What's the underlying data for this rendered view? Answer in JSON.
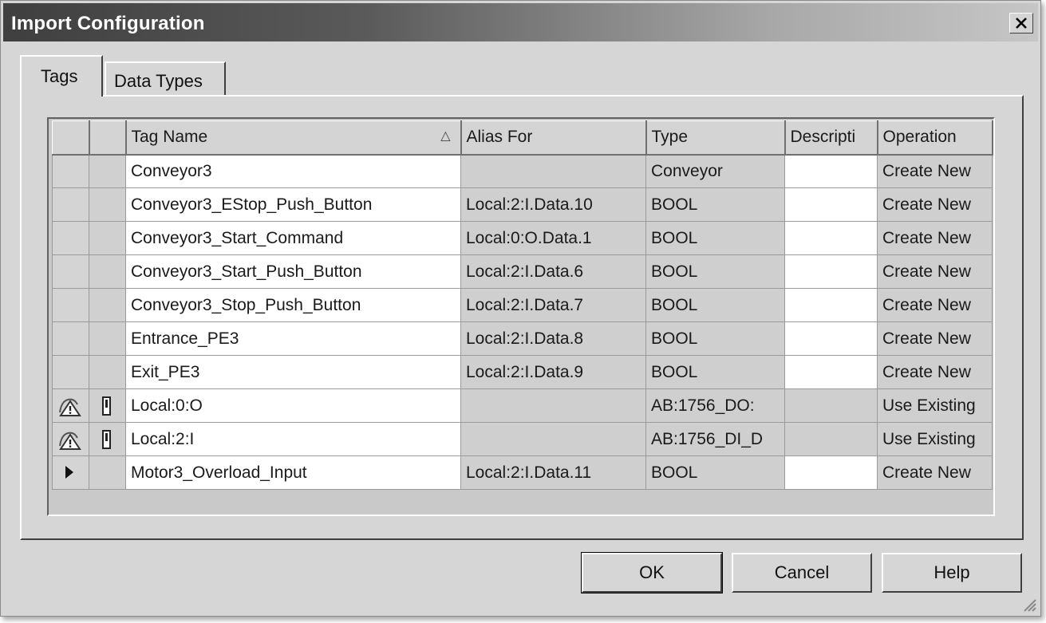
{
  "window": {
    "title": "Import Configuration",
    "close_icon": "close-icon"
  },
  "tabs": [
    {
      "label": "Tags",
      "selected": true
    },
    {
      "label": "Data Types",
      "selected": false
    }
  ],
  "grid": {
    "columns": [
      "",
      "",
      "Tag Name",
      "Alias For",
      "Type",
      "Descripti",
      "Operation"
    ],
    "sort_indicator": "△",
    "rows": [
      {
        "marker": "",
        "name": "Conveyor3",
        "alias": "",
        "type": "Conveyor",
        "description": "",
        "operation": "Create New"
      },
      {
        "marker": "",
        "name": "Conveyor3_EStop_Push_Button",
        "alias": "Local:2:I.Data.10",
        "type": "BOOL",
        "description": "",
        "operation": "Create New"
      },
      {
        "marker": "",
        "name": "Conveyor3_Start_Command",
        "alias": "Local:0:O.Data.1",
        "type": "BOOL",
        "description": "",
        "operation": "Create New"
      },
      {
        "marker": "",
        "name": "Conveyor3_Start_Push_Button",
        "alias": "Local:2:I.Data.6",
        "type": "BOOL",
        "description": "",
        "operation": "Create New"
      },
      {
        "marker": "",
        "name": "Conveyor3_Stop_Push_Button",
        "alias": "Local:2:I.Data.7",
        "type": "BOOL",
        "description": "",
        "operation": "Create New"
      },
      {
        "marker": "",
        "name": "Entrance_PE3",
        "alias": "Local:2:I.Data.8",
        "type": "BOOL",
        "description": "",
        "operation": "Create New"
      },
      {
        "marker": "",
        "name": "Exit_PE3",
        "alias": "Local:2:I.Data.9",
        "type": "BOOL",
        "description": "",
        "operation": "Create New"
      },
      {
        "marker": "warning",
        "name": "Local:0:O",
        "alias": "",
        "type": "AB:1756_DO:",
        "description": "",
        "operation": "Use Existing"
      },
      {
        "marker": "warning",
        "name": "Local:2:I",
        "alias": "",
        "type": "AB:1756_DI_D",
        "description": "",
        "operation": "Use Existing"
      },
      {
        "marker": "current",
        "name": "Motor3_Overload_Input",
        "alias": "Local:2:I.Data.11",
        "type": "BOOL",
        "description": "",
        "operation": "Create New"
      }
    ]
  },
  "buttons": {
    "ok": "OK",
    "cancel": "Cancel",
    "help": "Help"
  }
}
